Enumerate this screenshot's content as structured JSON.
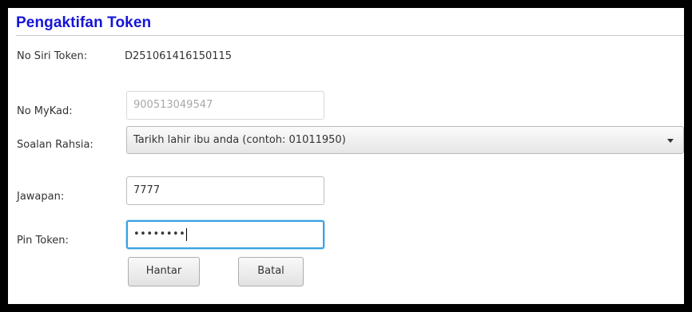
{
  "title": "Pengaktifan Token",
  "serial": {
    "label": "No Siri Token:",
    "value": "D251061416150115"
  },
  "mykad": {
    "label": "No MyKad:",
    "value": "900513049547"
  },
  "secret_question": {
    "label": "Soalan Rahsia:",
    "selected": "Tarikh lahir ibu anda (contoh: 01011950)"
  },
  "answer": {
    "label": "Jawapan:",
    "value": "7777"
  },
  "pin": {
    "label": "Pin Token:",
    "masked": "••••••••"
  },
  "buttons": {
    "submit": "Hantar",
    "cancel": "Batal"
  },
  "colors": {
    "title": "#1515d6",
    "focus": "#39a2e0",
    "frame": "#000000"
  },
  "icons": {
    "dropdown": "chevron-down-icon"
  }
}
